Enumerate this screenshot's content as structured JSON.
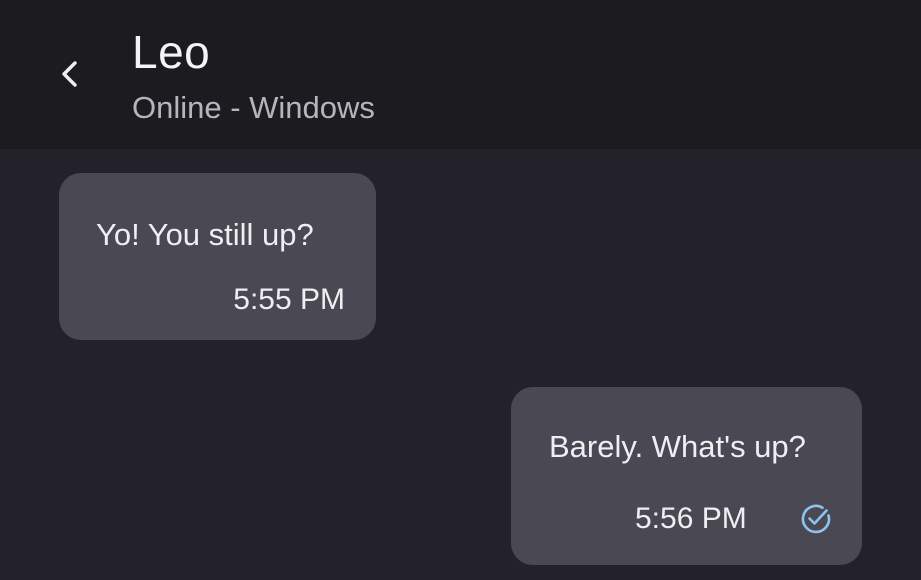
{
  "header": {
    "contact_name": "Leo",
    "status": "Online - Windows",
    "back_icon": "chevron-left-icon"
  },
  "messages": [
    {
      "direction": "incoming",
      "text": "Yo! You still up?",
      "time": "5:55 PM"
    },
    {
      "direction": "outgoing",
      "text": "Barely. What's up?",
      "time": "5:56 PM",
      "status_icon": "read-check-icon"
    }
  ],
  "colors": {
    "header_bg": "#1c1b20",
    "chat_bg": "#232129",
    "bubble_bg": "#4a4852",
    "text": "#efeff2",
    "status_text": "#b6b5bc",
    "read_check": "#8ec3f0"
  }
}
